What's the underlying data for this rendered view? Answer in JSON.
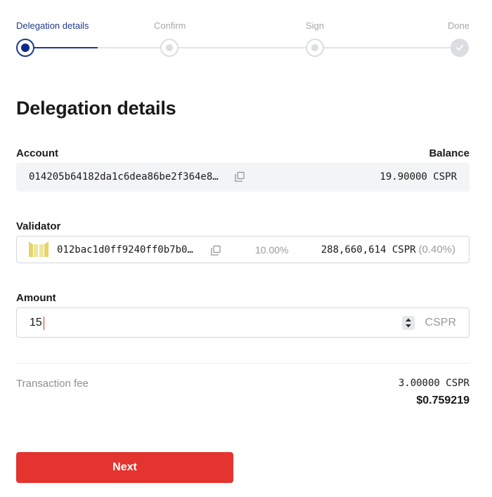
{
  "stepper": {
    "steps": [
      {
        "label": "Delegation details",
        "state": "active"
      },
      {
        "label": "Confirm",
        "state": "pending"
      },
      {
        "label": "Sign",
        "state": "pending"
      },
      {
        "label": "Done",
        "state": "done"
      }
    ]
  },
  "page": {
    "title": "Delegation details"
  },
  "account": {
    "label": "Account",
    "balance_label": "Balance",
    "hash": "014205b64182da1c6dea86be2f364e8…",
    "balance": "19.90000 CSPR",
    "copy_icon": "copy-icon"
  },
  "validator": {
    "label": "Validator",
    "hash": "012bac1d0ff9240ff0b7b0…",
    "fee": "10.00%",
    "stake": "288,660,614 CSPR",
    "stake_share": "(0.40%)",
    "avatar_icon": "validator-avatar-icon",
    "copy_icon": "copy-icon"
  },
  "amount": {
    "label": "Amount",
    "value": "15",
    "unit": "CSPR",
    "stepper_icon": "spinner-arrows-icon"
  },
  "transaction_fee": {
    "label": "Transaction fee",
    "cspr": "3.00000 CSPR",
    "usd": "$0.759219"
  },
  "actions": {
    "next_label": "Next"
  },
  "colors": {
    "accent": "#1e3a8a",
    "button": "#e3342f",
    "muted": "#9a9ba1"
  }
}
